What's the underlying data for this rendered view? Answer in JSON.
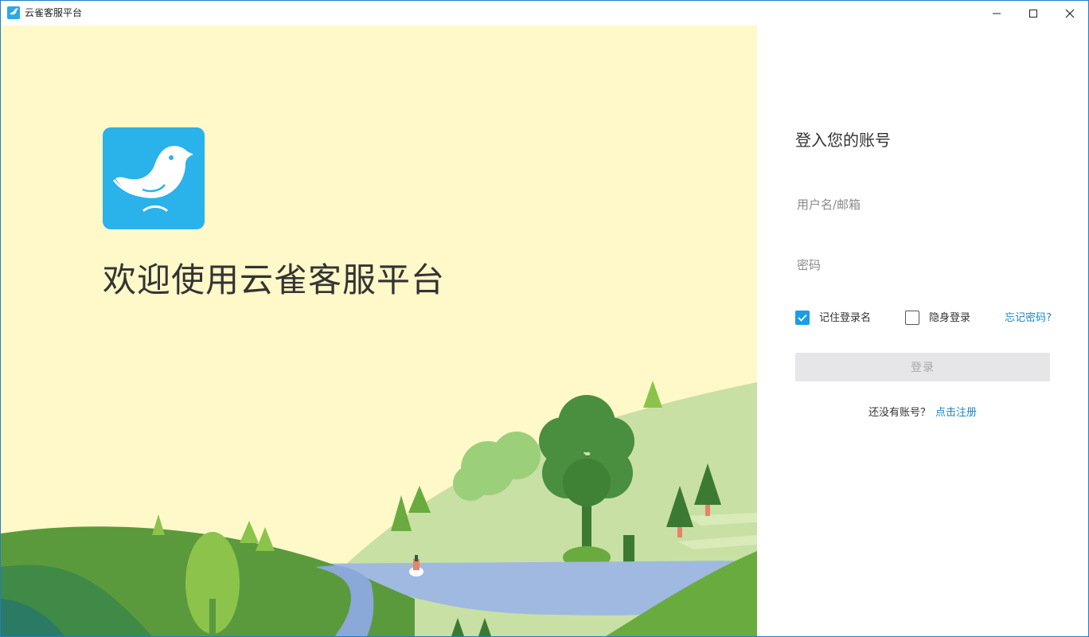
{
  "window": {
    "title": "云雀客服平台",
    "controls": {
      "minimize": "minimize-icon",
      "maximize": "maximize-icon",
      "close": "close-icon"
    }
  },
  "branding": {
    "logo_icon": "bird-logo-icon",
    "logo_color": "#2ab2ea",
    "welcome_text": "欢迎使用云雀客服平台",
    "background_color": "#fff8c8"
  },
  "login": {
    "heading": "登入您的账号",
    "username_placeholder": "用户名/邮箱",
    "password_placeholder": "密码",
    "remember_label": "记住登录名",
    "remember_checked": true,
    "hidden_label": "隐身登录",
    "hidden_checked": false,
    "forgot_link": "忘记密码?",
    "submit_label": "登录",
    "no_account_text": "还没有账号？",
    "register_link": "点击注册",
    "accent_color": "#1a86c9"
  }
}
